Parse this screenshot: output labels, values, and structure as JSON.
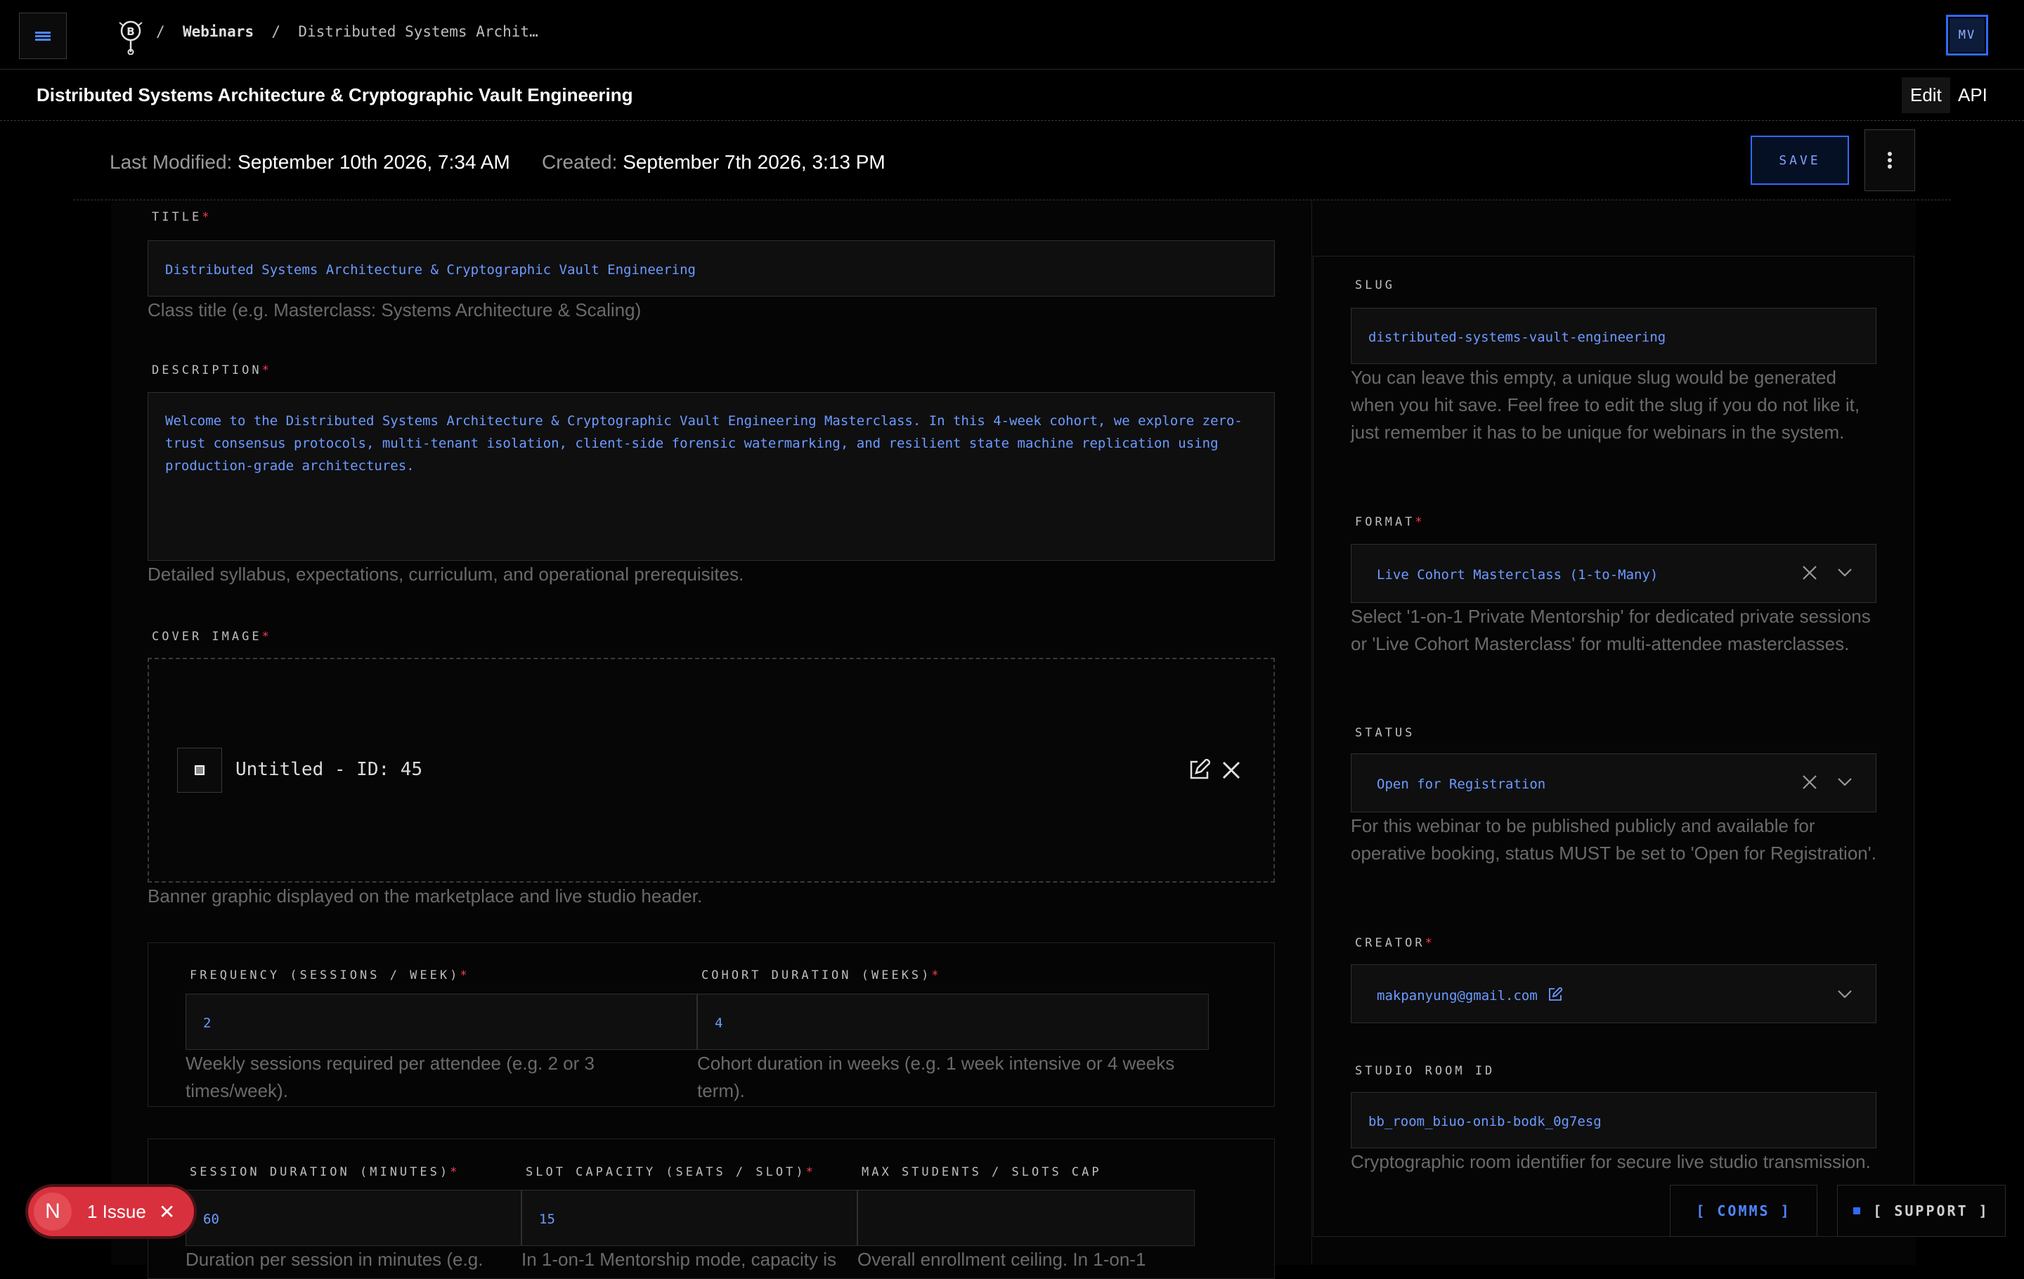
{
  "nav": {
    "breadcrumb_sep1": "/",
    "breadcrumb_section": "Webinars",
    "breadcrumb_sep2": "/",
    "breadcrumb_current": "Distributed Systems Archit…",
    "avatar_initials": "MV"
  },
  "header": {
    "title": "Distributed Systems Architecture & Cryptographic Vault Engineering",
    "tabs": [
      {
        "label": "Edit"
      },
      {
        "label": "API"
      }
    ]
  },
  "meta": {
    "last_modified_label": "Last Modified:",
    "last_modified_value": "September 10th 2026, 7:34 AM",
    "created_label": "Created:",
    "created_value": "September 7th 2026, 3:13 PM",
    "save_label": "SAVE"
  },
  "form": {
    "title": {
      "label": "TITLE",
      "value": "Distributed Systems Architecture & Cryptographic Vault Engineering",
      "help": "Class title (e.g. Masterclass: Systems Architecture & Scaling)"
    },
    "description": {
      "label": "DESCRIPTION",
      "value": "Welcome to the Distributed Systems Architecture & Cryptographic Vault Engineering Masterclass. In this 4-week cohort, we explore zero-trust consensus protocols, multi-tenant isolation, client-side forensic watermarking, and resilient state machine replication using production-grade architectures.",
      "help": "Detailed syllabus, expectations, curriculum, and operational prerequisites."
    },
    "cover": {
      "label": "COVER IMAGE",
      "file_name": "Untitled - ID: 45",
      "help": "Banner graphic displayed on the marketplace and live studio header."
    },
    "frequency": {
      "label": "FREQUENCY (SESSIONS / WEEK)",
      "value": "2",
      "help": "Weekly sessions required per attendee (e.g. 2 or 3 times/week)."
    },
    "cohort_duration": {
      "label": "COHORT DURATION (WEEKS)",
      "value": "4",
      "help": "Cohort duration in weeks (e.g. 1 week intensive or 4 weeks term)."
    },
    "session_duration": {
      "label": "SESSION DURATION (MINUTES)",
      "value": "60",
      "help": "Duration per session in minutes (e.g."
    },
    "slot_capacity": {
      "label": "SLOT CAPACITY (SEATS / SLOT)",
      "value": "15",
      "help": "In 1-on-1 Mentorship mode, capacity is"
    },
    "max_students": {
      "label": "MAX STUDENTS / SLOTS CAP",
      "value": "",
      "help": "Overall enrollment ceiling. In 1-on-1"
    },
    "required_mark": "*"
  },
  "side": {
    "slug": {
      "label": "SLUG",
      "value": "distributed-systems-vault-engineering",
      "help": "You can leave this empty, a unique slug would be generated when you hit save. Feel free to edit the slug if you do not like it, just remember it has to be unique for webinars in the system."
    },
    "format": {
      "label": "FORMAT",
      "value": "Live Cohort Masterclass (1-to-Many)",
      "help": "Select '1-on-1 Private Mentorship' for dedicated private sessions or 'Live Cohort Masterclass' for multi-attendee masterclasses."
    },
    "status": {
      "label": "STATUS",
      "value": "Open for Registration",
      "help": "For this webinar to be published publicly and available for operative booking, status MUST be set to 'Open for Registration'."
    },
    "creator": {
      "label": "CREATOR",
      "value": "makpanyung@gmail.com"
    },
    "studio_room": {
      "label": "STUDIO ROOM ID",
      "value": "bb_room_biuo-onib-bodk_0g7esg",
      "help": "Cryptographic room identifier for secure live studio transmission."
    }
  },
  "footer": {
    "issue_badge_letter": "N",
    "issue_text": "1 Issue",
    "comms_label": "[ COMMS ]",
    "support_label": "[ SUPPORT ]"
  },
  "colors": {
    "accent": "#2e6bff",
    "field_text": "#6d9bff",
    "required": "#ff3b55",
    "issue": "#d8313d"
  }
}
